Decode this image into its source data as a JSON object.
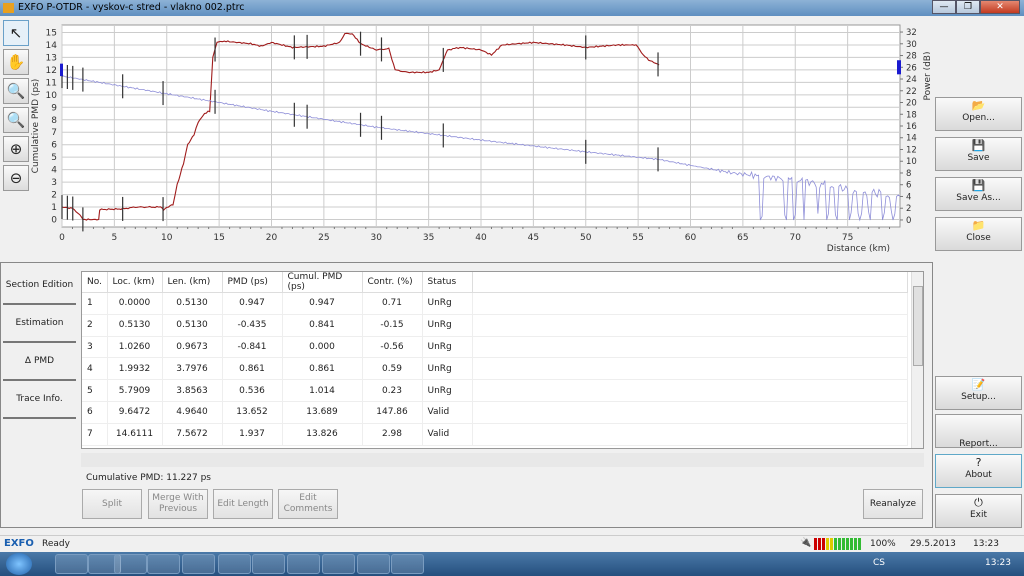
{
  "window": {
    "title": "EXFO P-OTDR - vyskov-c stred - vlakno 002.ptrc",
    "min": "—",
    "max": "❐",
    "close": "✕"
  },
  "tools": [
    {
      "name": "pointer-tool",
      "icon": "↖"
    },
    {
      "name": "pan-tool",
      "icon": "✋"
    },
    {
      "name": "zoom-region-tool",
      "icon": "🔍"
    },
    {
      "name": "zoom-1to1-tool",
      "icon": "🔍"
    },
    {
      "name": "zoom-in-tool",
      "icon": "⊕"
    },
    {
      "name": "zoom-out-tool",
      "icon": "⊖"
    }
  ],
  "chart_data": {
    "type": "line",
    "xlabel": "Distance (km)",
    "ylabel": "Cumulative PMD (ps)",
    "y2label": "Power (dB)",
    "xlim": [
      0,
      80
    ],
    "ylim": [
      -0.6,
      15.6
    ],
    "y2lim": [
      -1.2,
      33.2
    ],
    "xticks": [
      0,
      5,
      10,
      15,
      20,
      25,
      30,
      35,
      40,
      45,
      50,
      55,
      60,
      65,
      70,
      75
    ],
    "yticks": [
      0,
      1,
      2,
      3,
      4,
      5,
      6,
      7,
      8,
      9,
      10,
      11,
      12,
      13,
      14,
      15
    ],
    "y2ticks": [
      0,
      2,
      4,
      6,
      8,
      10,
      12,
      14,
      16,
      18,
      20,
      22,
      24,
      26,
      28,
      30,
      32
    ],
    "grid": true,
    "series": [
      {
        "axis": "left",
        "color": "#a01c1c",
        "points": [
          [
            0,
            1
          ],
          [
            1,
            0.9
          ],
          [
            1.7,
            0.4
          ],
          [
            2,
            0
          ],
          [
            3.5,
            0
          ],
          [
            3.6,
            0.8
          ],
          [
            5.8,
            0.85
          ],
          [
            7,
            1
          ],
          [
            9.4,
            1
          ],
          [
            9.7,
            0.8
          ],
          [
            10.3,
            1.1
          ],
          [
            10.6,
            1.2
          ],
          [
            11,
            2.8
          ],
          [
            11.6,
            4.5
          ],
          [
            12,
            6
          ],
          [
            12.6,
            6.8
          ],
          [
            13,
            7.8
          ],
          [
            13.6,
            8.5
          ],
          [
            14.1,
            8.7
          ],
          [
            14.4,
            13
          ],
          [
            14.8,
            14.2
          ],
          [
            15.5,
            14.3
          ],
          [
            18,
            14.1
          ],
          [
            19,
            13.9
          ],
          [
            20,
            14.2
          ],
          [
            22,
            13.8
          ],
          [
            25,
            13.9
          ],
          [
            26.5,
            14.2
          ],
          [
            27,
            14.9
          ],
          [
            27.7,
            14.9
          ],
          [
            28.5,
            14.1
          ],
          [
            30,
            13.6
          ],
          [
            31.2,
            13.7
          ],
          [
            31.8,
            12
          ],
          [
            33,
            11.8
          ],
          [
            35,
            11.8
          ],
          [
            36,
            12
          ],
          [
            36.8,
            13.6
          ],
          [
            38,
            13.8
          ],
          [
            40,
            13.6
          ],
          [
            41,
            13.2
          ],
          [
            42,
            14
          ],
          [
            45,
            14.2
          ],
          [
            48,
            14
          ],
          [
            50,
            13.8
          ],
          [
            53,
            14
          ],
          [
            54.8,
            14
          ],
          [
            55.5,
            13.2
          ],
          [
            56,
            12.8
          ],
          [
            57,
            12.4
          ]
        ]
      },
      {
        "axis": "right",
        "color": "#8e8ed8",
        "points": [
          [
            0,
            24.5
          ],
          [
            10,
            21.5
          ],
          [
            20,
            18.5
          ],
          [
            30,
            15.8
          ],
          [
            40,
            13.6
          ],
          [
            50,
            11.6
          ],
          [
            57,
            10.3
          ],
          [
            60,
            9.3
          ],
          [
            64,
            8
          ],
          [
            68,
            7.2
          ],
          [
            70,
            6.8
          ],
          [
            73,
            6
          ],
          [
            75,
            5.2
          ],
          [
            78,
            4.5
          ],
          [
            80,
            4
          ]
        ]
      }
    ],
    "markers": [
      0,
      0.513,
      1.026,
      1.993,
      5.791,
      9.647,
      14.611,
      22.18,
      23.4,
      28.5,
      30.5,
      36.4,
      50,
      56.9
    ],
    "cursor_y2": 26
  },
  "tabs": [
    "Section Edition",
    "Estimation",
    "Δ PMD",
    "Trace Info."
  ],
  "table": {
    "headers": [
      "No.",
      "Loc. (km)",
      "Len. (km)",
      "PMD (ps)",
      "Cumul. PMD (ps)",
      "Contr. (%)",
      "Status"
    ],
    "rows": [
      [
        "1",
        "0.0000",
        "0.5130",
        "0.947",
        "0.947",
        "0.71",
        "UnRg"
      ],
      [
        "2",
        "0.5130",
        "0.5130",
        "-0.435",
        "0.841",
        "-0.15",
        "UnRg"
      ],
      [
        "3",
        "1.0260",
        "0.9673",
        "-0.841",
        "0.000",
        "-0.56",
        "UnRg"
      ],
      [
        "4",
        "1.9932",
        "3.7976",
        "0.861",
        "0.861",
        "0.59",
        "UnRg"
      ],
      [
        "5",
        "5.7909",
        "3.8563",
        "0.536",
        "1.014",
        "0.23",
        "UnRg"
      ],
      [
        "6",
        "9.6472",
        "4.9640",
        "13.652",
        "13.689",
        "147.86",
        "Valid"
      ],
      [
        "7",
        "14.6111",
        "7.5672",
        "1.937",
        "13.826",
        "2.98",
        "Valid"
      ]
    ]
  },
  "cumulative": "Cumulative PMD: 11.227 ps",
  "buttons": {
    "split": "Split",
    "merge": "Merge With Previous",
    "edit_length": "Edit Length",
    "edit_comments": "Edit Comments",
    "reanalyze": "Reanalyze"
  },
  "side": [
    {
      "label": "Open...",
      "icon": "📂"
    },
    {
      "label": "Save",
      "icon": "💾"
    },
    {
      "label": "Save As...",
      "icon": "💾"
    },
    {
      "label": "Close",
      "icon": "📁"
    },
    {
      "label": "Setup...",
      "icon": "📝"
    },
    {
      "label": "Report...",
      "icon": ""
    },
    {
      "label": "About",
      "icon": "?"
    },
    {
      "label": "Exit",
      "icon": "⏻"
    }
  ],
  "status": {
    "brand": "EXFO",
    "text": "Ready",
    "battery": "100%",
    "battery_level": 1.0,
    "date": "29.5.2013",
    "time": "13:23"
  },
  "taskbar": {
    "lang": "CS",
    "time": "13:23"
  }
}
